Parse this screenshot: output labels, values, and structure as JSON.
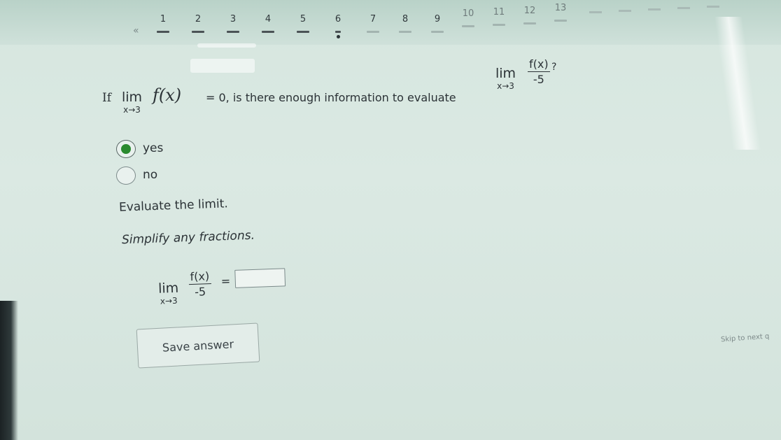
{
  "nav": {
    "back_label": "«",
    "items": [
      {
        "label": "1"
      },
      {
        "label": "2"
      },
      {
        "label": "3"
      },
      {
        "label": "4"
      },
      {
        "label": "5"
      },
      {
        "label": "6"
      },
      {
        "label": "7"
      },
      {
        "label": "8"
      },
      {
        "label": "9"
      },
      {
        "label": "10"
      },
      {
        "label": "11"
      },
      {
        "label": "12"
      },
      {
        "label": "13"
      }
    ],
    "current": "6"
  },
  "question": {
    "if_label": "If",
    "lim_word": "lim",
    "lim_sub": "x→3",
    "fx": "f(x)",
    "equals_zero": "= 0",
    "text": ", is there enough information to evaluate",
    "frac_num": "f(x)",
    "frac_den": "-5",
    "question_mark": "?"
  },
  "options": [
    {
      "label": "yes",
      "selected": true
    },
    {
      "label": "no",
      "selected": false
    }
  ],
  "evaluate_label": "Evaluate the limit.",
  "simplify_label": "Simplify any fractions.",
  "answer": {
    "lim_word": "lim",
    "lim_sub": "x→3",
    "frac_num": "f(x)",
    "frac_den": "-5",
    "equals": "=",
    "value": ""
  },
  "save_label": "Save answer",
  "skip_label": "Skip to next q",
  "colors": {
    "selected_radio": "#2a8a2f",
    "background": "#d9e7e1"
  }
}
